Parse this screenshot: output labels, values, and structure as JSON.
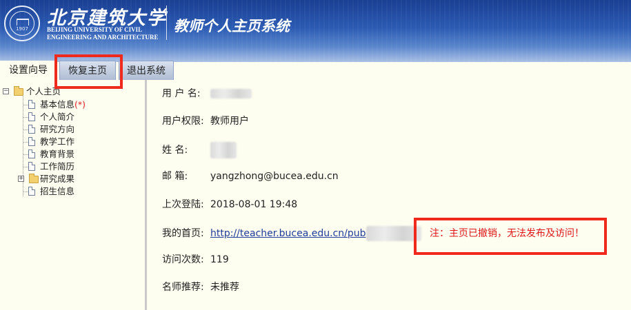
{
  "header": {
    "logo_name": "北京建筑大学",
    "logo_en_line1": "BEIJING UNIVERSITY OF CIVIL",
    "logo_en_line2": "ENGINEERING AND ARCHITECTURE",
    "seal_year": "1907",
    "system_title": "教师个人主页系统"
  },
  "tabs": [
    {
      "label": "设置向导"
    },
    {
      "label": "恢复主页"
    },
    {
      "label": "退出系统"
    }
  ],
  "tree": {
    "root_label": "个人主页",
    "items": [
      {
        "label": "基本信息",
        "required_mark": "(*)"
      },
      {
        "label": "个人简介"
      },
      {
        "label": "研究方向"
      },
      {
        "label": "教学工作"
      },
      {
        "label": "教育背景"
      },
      {
        "label": "工作简历"
      },
      {
        "label": "研究成果"
      },
      {
        "label": "招生信息"
      }
    ]
  },
  "info": {
    "username_label": "用 户 名:",
    "permission_label": "用户权限:",
    "permission_value": "教师用户",
    "name_label": "姓 名:",
    "email_label": "邮 箱:",
    "email_value": "yangzhong@bucea.edu.cn",
    "last_login_label": "上次登陆:",
    "last_login_value": "2018-08-01 19:48",
    "homepage_label": "我的首页:",
    "homepage_value": "http://teacher.bucea.edu.cn/pub",
    "visits_label": "访问次数:",
    "visits_value": "119",
    "recommend_label": "名师推荐:",
    "recommend_value": "未推荐",
    "notice": "注：主页已撤销，无法发布及访问！"
  },
  "colors": {
    "header_blue": "#1a3f93",
    "highlight_red": "#f0291d",
    "notice_red": "#e01818",
    "content_bg": "#fdfdf0"
  }
}
